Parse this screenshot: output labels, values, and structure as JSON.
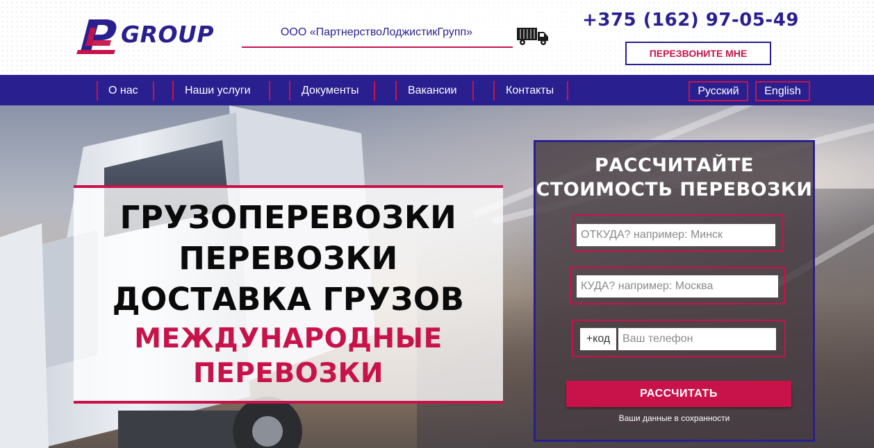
{
  "header": {
    "logo_text": "GROUP",
    "company_name": "ООО «ПартнерствоЛоджистикГрупп»",
    "phone": "+375 (162) 97-05-49",
    "callback_label": "ПЕРЕЗВОНИТЕ МНЕ"
  },
  "nav": {
    "items": [
      {
        "label": "О нас"
      },
      {
        "label": "Наши услуги"
      },
      {
        "label": "Документы"
      },
      {
        "label": "Вакансии"
      },
      {
        "label": "Контакты"
      }
    ],
    "languages": [
      {
        "label": "Русский"
      },
      {
        "label": "English"
      }
    ]
  },
  "hero": {
    "headline_lines": [
      "ГРУЗОПЕРЕВОЗКИ",
      "ПЕРЕВОЗКИ",
      "ДОСТАВКА ГРУЗОВ"
    ],
    "accent_lines": [
      "МЕЖДУНАРОДНЫЕ",
      "ПЕРЕВОЗКИ"
    ]
  },
  "calc_form": {
    "title_line1": "РАССЧИТАЙТЕ",
    "title_line2": "СТОИМОСТЬ ПЕРЕВОЗКИ",
    "from_placeholder": "ОТКУДА? например: Минск",
    "to_placeholder": "КУДА? например: Москва",
    "phone_code": "+код",
    "phone_placeholder": "Ваш телефон",
    "submit_label": "РАССЧИТАТЬ",
    "privacy_note": "Ваши данные в сохранности"
  },
  "colors": {
    "brand_blue": "#2a1f8f",
    "brand_red": "#c7134a"
  },
  "icons": [
    "logo-pl-icon",
    "truck-icon"
  ]
}
